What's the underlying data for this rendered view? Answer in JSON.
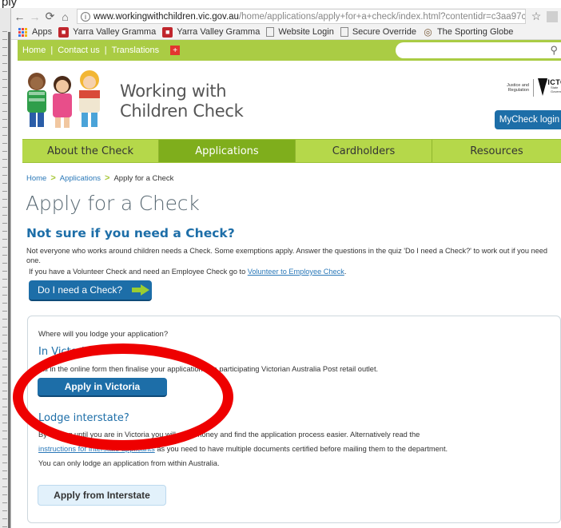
{
  "browser": {
    "url_host": "www.workingwithchildren.vic.gov.au",
    "url_path": "/home/applications/apply+for+a+check/index.html?contentidr=c3aa97ce-861b-41...",
    "info_glyph": "i",
    "bookmarks": [
      {
        "label": "Apps",
        "icon": "apps-grid-icon"
      },
      {
        "label": "Yarra Valley Gramma",
        "icon": "school-crest-icon"
      },
      {
        "label": "Yarra Valley Gramma",
        "icon": "school-crest-icon"
      },
      {
        "label": "Website Login",
        "icon": "page-icon"
      },
      {
        "label": "Secure Override",
        "icon": "page-icon"
      },
      {
        "label": "The Sporting Globe",
        "icon": "globe-icon"
      }
    ]
  },
  "site": {
    "utility_nav": [
      "Home",
      "Contact us",
      "Translations"
    ],
    "header_title_line1": "Working with",
    "header_title_line2": "Children Check",
    "gov_justice": "Justice and Regulation",
    "gov_vic": "VICTORIA",
    "gov_sub": "State Government",
    "mycheck_label": "MyCheck login",
    "main_nav": [
      {
        "label": "About the Check",
        "active": false
      },
      {
        "label": "Applications",
        "active": true
      },
      {
        "label": "Cardholders",
        "active": false
      },
      {
        "label": "Resources",
        "active": false
      }
    ],
    "colors": {
      "accent_green": "#b5d84a",
      "active_green": "#7fae1c",
      "brand_blue": "#1d6ea8",
      "annotation_red": "#ee0000"
    }
  },
  "breadcrumb": {
    "home": "Home",
    "applications": "Applications",
    "current": "Apply for a Check"
  },
  "content": {
    "page_title": "Apply for a Check",
    "sub_title": "Not sure if you need a Check?",
    "para1": "Not everyone who works around children needs a Check. Some exemptions apply. Answer the questions in the quiz 'Do I need a Check?' to work out if you need one.",
    "para2_prefix": "If you have a Volunteer Check and need an Employee Check go to ",
    "para2_link": "Volunteer to Employee Check",
    "para2_suffix": ".",
    "need_btn": "Do I need a Check?"
  },
  "panel": {
    "question": "Where will you lodge your application?",
    "in_vic_heading": "In Victoria",
    "vic_desc": "Fill in the online form then finalise your application at a participating Victorian Australia Post retail outlet.",
    "apply_vic_btn": "Apply in Victoria",
    "interstate_heading": "Lodge interstate?",
    "inter_desc1": "By waiting until you are in Victoria you will save money and find the application process easier. Alternatively read the",
    "inter_link": "instructions for interstate applicants",
    "inter_desc2_suffix": " as you need to have multiple documents certified before mailing them to the department.",
    "inter_desc3": "You can only lodge an application from within Australia.",
    "apply_inter_btn": "Apply from Interstate"
  }
}
